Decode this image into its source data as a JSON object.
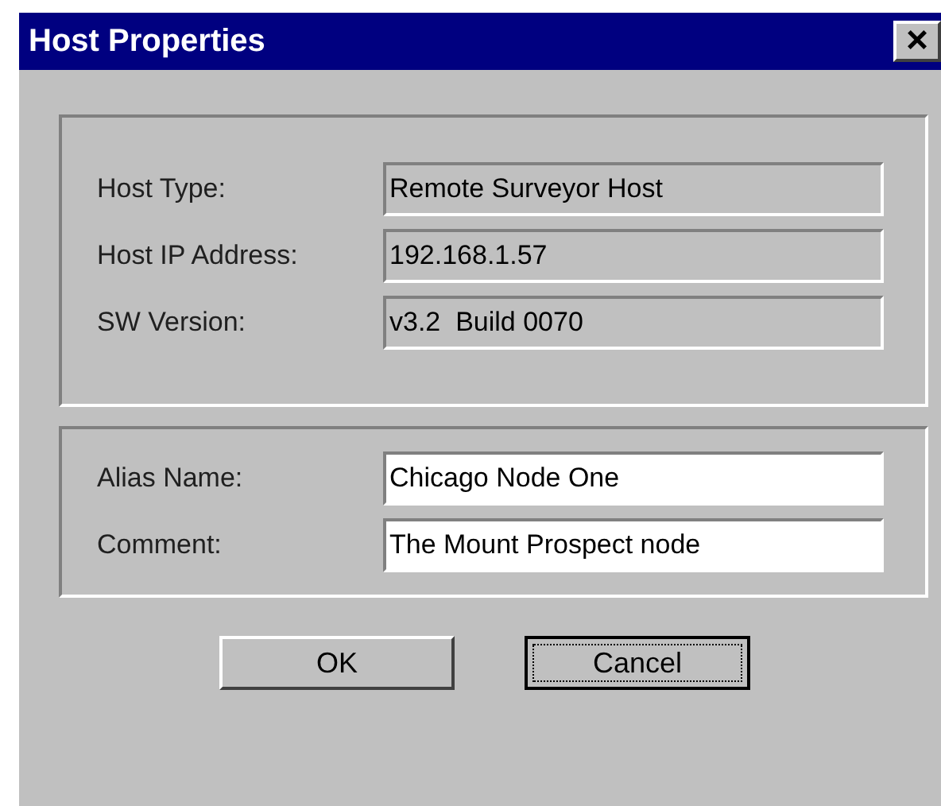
{
  "window": {
    "title": "Host Properties",
    "close": "×"
  },
  "groups": [
    {
      "fields": [
        {
          "label": "Host Type:",
          "value": "Remote Surveyor Host",
          "read_only": true
        },
        {
          "label": "Host IP Address:",
          "value": "192.168.1.57",
          "read_only": true
        },
        {
          "label": "SW Version:",
          "value": "v3.2  Build 0070",
          "read_only": true
        }
      ]
    },
    {
      "fields": [
        {
          "label": "Alias Name:",
          "value": "Chicago Node One",
          "read_only": false
        },
        {
          "label": "Comment:",
          "value": "The Mount Prospect node",
          "read_only": false
        }
      ]
    }
  ],
  "buttons": [
    {
      "label": "OK",
      "default": false
    },
    {
      "label": "Cancel",
      "default": true
    }
  ]
}
